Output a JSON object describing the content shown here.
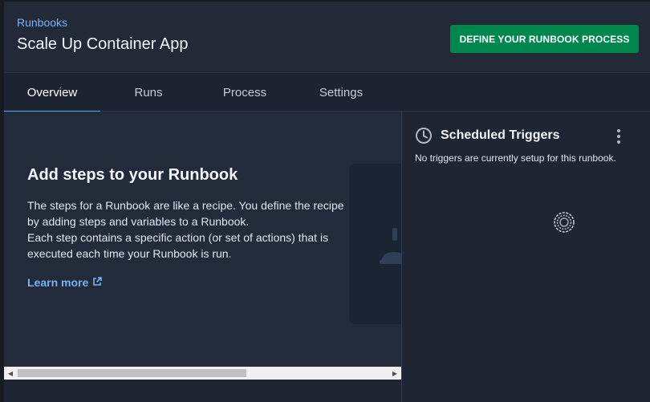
{
  "header": {
    "breadcrumb": "Runbooks",
    "title": "Scale Up Container App",
    "primary_button": "DEFINE YOUR RUNBOOK PROCESS"
  },
  "tabs": [
    {
      "label": "Overview",
      "active": true
    },
    {
      "label": "Runs",
      "active": false
    },
    {
      "label": "Process",
      "active": false
    },
    {
      "label": "Settings",
      "active": false
    }
  ],
  "main": {
    "heading": "Add steps to your Runbook",
    "paragraph_1": "The steps for a Runbook are like a recipe. You define the recipe by adding steps and variables to a Runbook.",
    "paragraph_2": "Each step contains a specific action (or set of actions) that is executed each time your Runbook is run.",
    "learn_more": "Learn more",
    "learn_more_icon": "external-link-icon"
  },
  "side_panel": {
    "title": "Scheduled Triggers",
    "title_icon": "clock-icon",
    "menu_icon": "more-vertical-icon",
    "empty_message": "No triggers are currently setup for this runbook."
  },
  "colors": {
    "accent": "#76b3f5",
    "primary_button": "#00874d",
    "background": "#1f2533"
  }
}
